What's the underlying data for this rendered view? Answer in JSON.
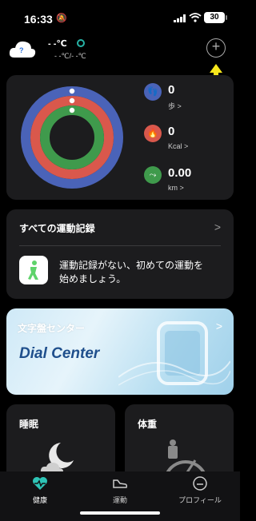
{
  "status_bar": {
    "time": "16:33",
    "battery": "30"
  },
  "weather": {
    "icon": "cloud-icon",
    "icon_glyph": "?",
    "temp": "- -℃",
    "range": "- -℃/- -℃"
  },
  "activity": {
    "steps": {
      "value": "0",
      "unit": "歩"
    },
    "calories": {
      "value": "0",
      "unit": "Kcal"
    },
    "distance": {
      "value": "0.00",
      "unit": "km"
    },
    "colors": {
      "steps": "#4a63b8",
      "calories": "#d9584c",
      "distance": "#3f9a4c"
    }
  },
  "records": {
    "title": "すべての運動記録",
    "message_line1": "運動記録がない、初めての運動を",
    "message_line2": "始めましょう。"
  },
  "dial_center": {
    "title": "文字盤センター",
    "banner": "Dial Center"
  },
  "cards": {
    "sleep": "睡眠",
    "weight": "体重"
  },
  "tabs": [
    {
      "label": "健康",
      "icon": "heart-pulse-icon",
      "active": true
    },
    {
      "label": "運動",
      "icon": "shoe-icon",
      "active": false
    },
    {
      "label": "プロフィール",
      "icon": "profile-face-icon",
      "active": false
    }
  ],
  "chevron": ">",
  "accent": "#2ec4b6",
  "highlight_arrow": "#f7e71c"
}
